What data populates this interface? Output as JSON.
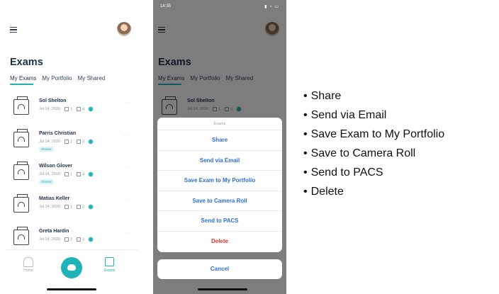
{
  "colors": {
    "accent": "#21b2b7",
    "action_blue": "#2b6fd6",
    "destructive": "#e0322b",
    "title_navy": "#1f2f46"
  },
  "left_screen": {
    "title": "Exams",
    "tabs": [
      {
        "label": "My Exams",
        "active": true
      },
      {
        "label": "My Portfolio",
        "active": false
      },
      {
        "label": "My Shared",
        "active": false
      }
    ],
    "exams": [
      {
        "name": "Sol Shelton",
        "date": "Jul 14, 2020",
        "count_a": "1",
        "count_b": "4",
        "shared": ""
      },
      {
        "name": "Parris Christian",
        "date": "Jul 14, 2020",
        "count_a": "1",
        "count_b": "3",
        "shared": "Shared"
      },
      {
        "name": "Wilson Glover",
        "date": "Jul 14, 2020",
        "count_a": "1",
        "count_b": "4",
        "shared": "Shared"
      },
      {
        "name": "Matias Keller",
        "date": "Jul 14, 2020",
        "count_a": "1",
        "count_b": "2",
        "shared": ""
      },
      {
        "name": "Greta Hardin",
        "date": "Jul 14, 2020",
        "count_a": "2",
        "count_b": "3",
        "shared": ""
      }
    ],
    "nav": {
      "home_label": "Home",
      "exams_label": "Exams"
    },
    "icons": {
      "menu": "hamburger-icon",
      "exam": "exam-folder-icon",
      "more": "more-dots-icon",
      "visibility": "eye-icon"
    }
  },
  "right_screen": {
    "status_time": "14:35",
    "title": "Exams",
    "tabs": [
      {
        "label": "My Exams",
        "active": true
      },
      {
        "label": "My Portfolio",
        "active": false
      },
      {
        "label": "My Shared",
        "active": false
      }
    ],
    "preview_exam": {
      "name": "Sol Shelton",
      "date": "Jul 14, 2020",
      "count_a": "1",
      "count_b": "4"
    },
    "sheet": {
      "title": "Exams",
      "actions": [
        {
          "label": "Share",
          "destructive": false
        },
        {
          "label": "Send via Email",
          "destructive": false
        },
        {
          "label": "Save Exam to My Portfolio",
          "destructive": false
        },
        {
          "label": "Save to Camera Roll",
          "destructive": false
        },
        {
          "label": "Send to PACS",
          "destructive": false
        },
        {
          "label": "Delete",
          "destructive": true
        }
      ],
      "cancel_label": "Cancel"
    }
  },
  "bullet_list": [
    "Share",
    "Send via Email",
    "Save Exam to My Portfolio",
    "Save to Camera Roll",
    "Send to PACS",
    "Delete"
  ]
}
